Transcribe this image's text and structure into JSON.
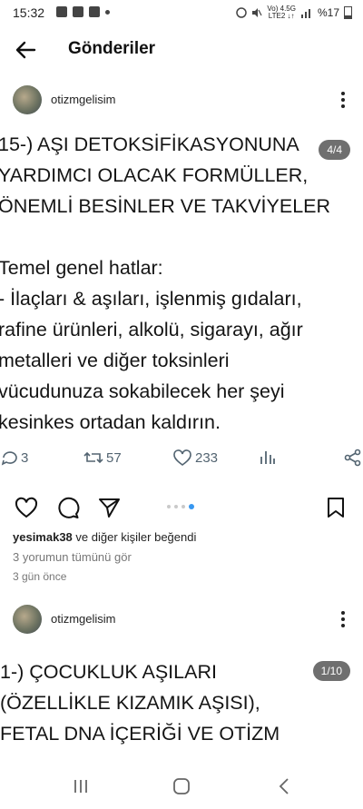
{
  "status_bar": {
    "time": "15:32",
    "net_top": "Vo) 4.5G",
    "net_bottom": "LTE2 ↓↑",
    "battery": "%17"
  },
  "header": {
    "title": "Gönderiler"
  },
  "post1": {
    "username": "otizmgelisim",
    "counter": "4/4",
    "lines": [
      "15-) AŞI DETOKSİFİKASYONUNA",
      "YARDIMCI OLACAK FORMÜLLER,",
      "ÖNEMLİ BESİNLER VE TAKVİYELER",
      "",
      "Temel genel hatlar:",
      "- İlaçları & aşıları, işlenmiş gıdaları,",
      "rafine ürünleri, alkolü, sigarayı, ağır",
      "metalleri ve diğer toksinleri",
      "vücudunuza sokabilecek her şeyi",
      "kesinkes ortadan kaldırın."
    ],
    "stats": {
      "replies": "3",
      "retweets": "57",
      "likes": "233"
    },
    "liked_by": "yesimak38 ve diğer kişiler beğendi",
    "liked_by_user": "yesimak38",
    "liked_by_rest": " ve diğer kişiler beğendi",
    "view_comments": "3 yorumun tümünü gör",
    "date": "3 gün önce",
    "carousel": {
      "total": 4,
      "active": 4
    }
  },
  "post2": {
    "username": "otizmgelisim",
    "counter": "1/10",
    "lines": [
      "1-) ÇOCUKLUK AŞILARI",
      "(ÖZELLİKLE KIZAMIK AŞISI),",
      "FETAL DNA İÇERİĞİ VE OTİZM"
    ]
  },
  "colors": {
    "accent_dot": "#3797f0",
    "stat_gray": "#536471",
    "text": "#141414"
  }
}
